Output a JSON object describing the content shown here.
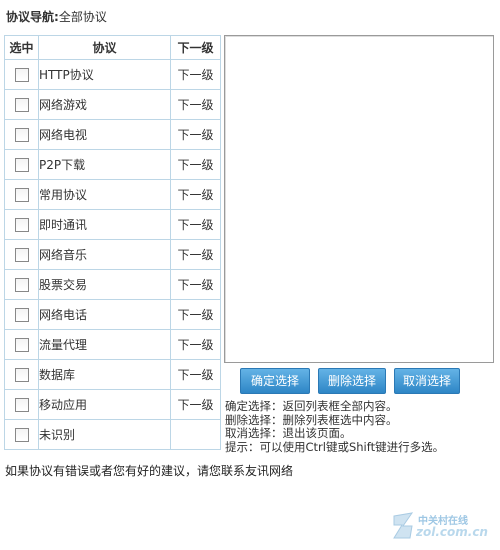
{
  "nav": {
    "label": "协议导航:",
    "current": "全部协议"
  },
  "table": {
    "headers": {
      "select": "选中",
      "protocol": "协议",
      "next": "下一级"
    },
    "rows": [
      {
        "name": "HTTP协议",
        "next": "下一级",
        "checked": false
      },
      {
        "name": "网络游戏",
        "next": "下一级",
        "checked": false
      },
      {
        "name": "网络电视",
        "next": "下一级",
        "checked": false
      },
      {
        "name": "P2P下载",
        "next": "下一级",
        "checked": false
      },
      {
        "name": "常用协议",
        "next": "下一级",
        "checked": false
      },
      {
        "name": "即时通讯",
        "next": "下一级",
        "checked": false
      },
      {
        "name": "网络音乐",
        "next": "下一级",
        "checked": false
      },
      {
        "name": "股票交易",
        "next": "下一级",
        "checked": false
      },
      {
        "name": "网络电话",
        "next": "下一级",
        "checked": false
      },
      {
        "name": "流量代理",
        "next": "下一级",
        "checked": false
      },
      {
        "name": "数据库",
        "next": "下一级",
        "checked": false
      },
      {
        "name": "移动应用",
        "next": "下一级",
        "checked": false
      },
      {
        "name": "未识别",
        "next": "",
        "checked": false
      }
    ]
  },
  "buttons": {
    "confirm": "确定选择",
    "delete": "删除选择",
    "cancel": "取消选择"
  },
  "help": {
    "confirm": "确定选择：返回列表框全部内容。",
    "delete": "删除选择：删除列表框选中内容。",
    "cancel": "取消选择：退出该页面。",
    "tip": "提示：可以使用Ctrl键或Shift键进行多选。"
  },
  "footer": "如果协议有错误或者您有好的建议，请您联系友讯网络",
  "watermark": {
    "line1": "中关村在线",
    "line2": "zol.com.cn"
  },
  "colors": {
    "button": "#2e86c6",
    "table_border": "#bcd6e6"
  }
}
